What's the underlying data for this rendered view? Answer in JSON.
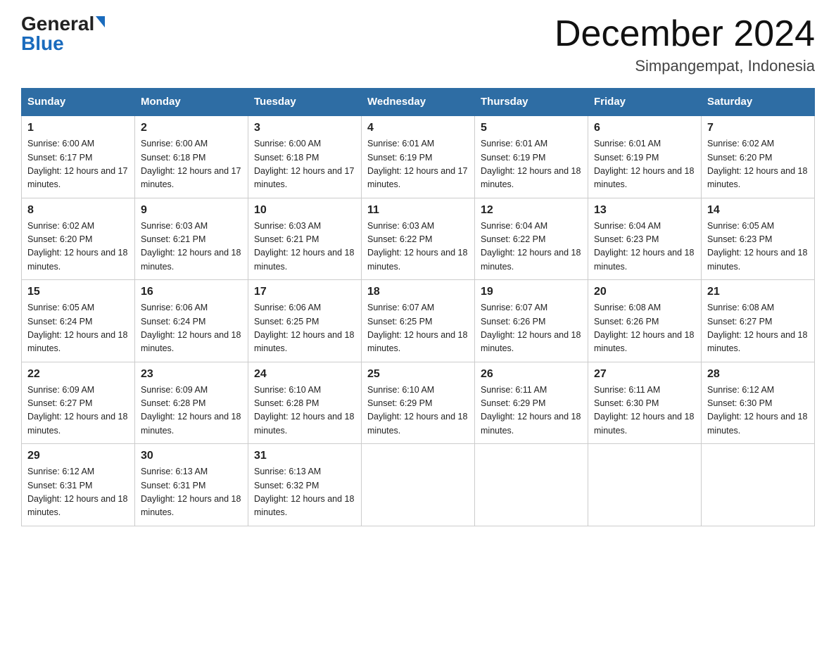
{
  "logo": {
    "general": "General",
    "blue": "Blue"
  },
  "title": "December 2024",
  "subtitle": "Simpangempat, Indonesia",
  "days_of_week": [
    "Sunday",
    "Monday",
    "Tuesday",
    "Wednesday",
    "Thursday",
    "Friday",
    "Saturday"
  ],
  "weeks": [
    [
      {
        "day": "1",
        "sunrise": "6:00 AM",
        "sunset": "6:17 PM",
        "daylight": "12 hours and 17 minutes."
      },
      {
        "day": "2",
        "sunrise": "6:00 AM",
        "sunset": "6:18 PM",
        "daylight": "12 hours and 17 minutes."
      },
      {
        "day": "3",
        "sunrise": "6:00 AM",
        "sunset": "6:18 PM",
        "daylight": "12 hours and 17 minutes."
      },
      {
        "day": "4",
        "sunrise": "6:01 AM",
        "sunset": "6:19 PM",
        "daylight": "12 hours and 17 minutes."
      },
      {
        "day": "5",
        "sunrise": "6:01 AM",
        "sunset": "6:19 PM",
        "daylight": "12 hours and 18 minutes."
      },
      {
        "day": "6",
        "sunrise": "6:01 AM",
        "sunset": "6:19 PM",
        "daylight": "12 hours and 18 minutes."
      },
      {
        "day": "7",
        "sunrise": "6:02 AM",
        "sunset": "6:20 PM",
        "daylight": "12 hours and 18 minutes."
      }
    ],
    [
      {
        "day": "8",
        "sunrise": "6:02 AM",
        "sunset": "6:20 PM",
        "daylight": "12 hours and 18 minutes."
      },
      {
        "day": "9",
        "sunrise": "6:03 AM",
        "sunset": "6:21 PM",
        "daylight": "12 hours and 18 minutes."
      },
      {
        "day": "10",
        "sunrise": "6:03 AM",
        "sunset": "6:21 PM",
        "daylight": "12 hours and 18 minutes."
      },
      {
        "day": "11",
        "sunrise": "6:03 AM",
        "sunset": "6:22 PM",
        "daylight": "12 hours and 18 minutes."
      },
      {
        "day": "12",
        "sunrise": "6:04 AM",
        "sunset": "6:22 PM",
        "daylight": "12 hours and 18 minutes."
      },
      {
        "day": "13",
        "sunrise": "6:04 AM",
        "sunset": "6:23 PM",
        "daylight": "12 hours and 18 minutes."
      },
      {
        "day": "14",
        "sunrise": "6:05 AM",
        "sunset": "6:23 PM",
        "daylight": "12 hours and 18 minutes."
      }
    ],
    [
      {
        "day": "15",
        "sunrise": "6:05 AM",
        "sunset": "6:24 PM",
        "daylight": "12 hours and 18 minutes."
      },
      {
        "day": "16",
        "sunrise": "6:06 AM",
        "sunset": "6:24 PM",
        "daylight": "12 hours and 18 minutes."
      },
      {
        "day": "17",
        "sunrise": "6:06 AM",
        "sunset": "6:25 PM",
        "daylight": "12 hours and 18 minutes."
      },
      {
        "day": "18",
        "sunrise": "6:07 AM",
        "sunset": "6:25 PM",
        "daylight": "12 hours and 18 minutes."
      },
      {
        "day": "19",
        "sunrise": "6:07 AM",
        "sunset": "6:26 PM",
        "daylight": "12 hours and 18 minutes."
      },
      {
        "day": "20",
        "sunrise": "6:08 AM",
        "sunset": "6:26 PM",
        "daylight": "12 hours and 18 minutes."
      },
      {
        "day": "21",
        "sunrise": "6:08 AM",
        "sunset": "6:27 PM",
        "daylight": "12 hours and 18 minutes."
      }
    ],
    [
      {
        "day": "22",
        "sunrise": "6:09 AM",
        "sunset": "6:27 PM",
        "daylight": "12 hours and 18 minutes."
      },
      {
        "day": "23",
        "sunrise": "6:09 AM",
        "sunset": "6:28 PM",
        "daylight": "12 hours and 18 minutes."
      },
      {
        "day": "24",
        "sunrise": "6:10 AM",
        "sunset": "6:28 PM",
        "daylight": "12 hours and 18 minutes."
      },
      {
        "day": "25",
        "sunrise": "6:10 AM",
        "sunset": "6:29 PM",
        "daylight": "12 hours and 18 minutes."
      },
      {
        "day": "26",
        "sunrise": "6:11 AM",
        "sunset": "6:29 PM",
        "daylight": "12 hours and 18 minutes."
      },
      {
        "day": "27",
        "sunrise": "6:11 AM",
        "sunset": "6:30 PM",
        "daylight": "12 hours and 18 minutes."
      },
      {
        "day": "28",
        "sunrise": "6:12 AM",
        "sunset": "6:30 PM",
        "daylight": "12 hours and 18 minutes."
      }
    ],
    [
      {
        "day": "29",
        "sunrise": "6:12 AM",
        "sunset": "6:31 PM",
        "daylight": "12 hours and 18 minutes."
      },
      {
        "day": "30",
        "sunrise": "6:13 AM",
        "sunset": "6:31 PM",
        "daylight": "12 hours and 18 minutes."
      },
      {
        "day": "31",
        "sunrise": "6:13 AM",
        "sunset": "6:32 PM",
        "daylight": "12 hours and 18 minutes."
      },
      null,
      null,
      null,
      null
    ]
  ]
}
